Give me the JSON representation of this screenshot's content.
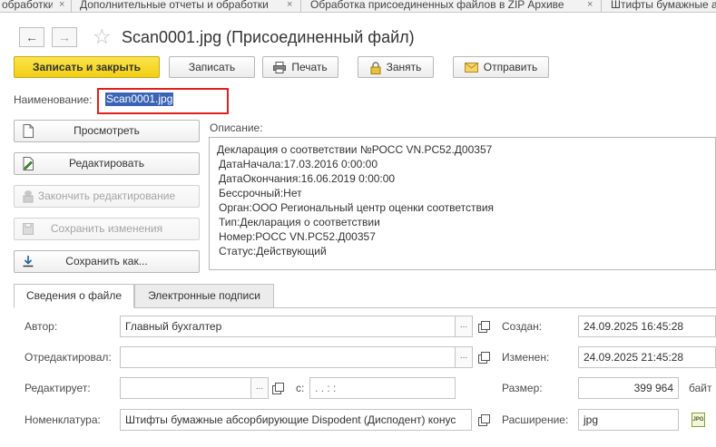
{
  "tabs": [
    {
      "label": "обработки"
    },
    {
      "label": "Дополнительные отчеты и обработки"
    },
    {
      "label": "Обработка присоединенных файлов в ZIP Архиве"
    },
    {
      "label": "Штифты бумажные а"
    }
  ],
  "tab_close_glyph": "×",
  "nav": {
    "back": "←",
    "forward": "→",
    "favorite": "☆"
  },
  "title": "Scan0001.jpg (Присоединенный файл)",
  "toolbar": {
    "save_close": "Записать и закрыть",
    "save": "Записать",
    "print": "Печать",
    "lock": "Занять",
    "send": "Отправить"
  },
  "name": {
    "label": "Наименование:",
    "value": "Scan0001.jpg"
  },
  "actions": {
    "view": "Просмотреть",
    "edit": "Редактировать",
    "finish_edit": "Закончить редактирование",
    "save_changes": "Сохранить изменения",
    "save_as": "Сохранить как..."
  },
  "description": {
    "label": "Описание:",
    "lines": [
      "Декларация о соответствии №РОСС VN.PC52.Д00357",
      "ДатаНачала:17.03.2016 0:00:00",
      "ДатаОкончания:16.06.2019 0:00:00",
      "Бессрочный:Нет",
      "Орган:ООО Региональный центр оценки соответствия",
      "Тип:Декларация о соответствии",
      "Номер:РОСС VN.PC52.Д00357",
      "Статус:Действующий"
    ]
  },
  "lower_tabs": {
    "info": "Сведения о файле",
    "signatures": "Электронные подписи"
  },
  "fields": {
    "author": {
      "label": "Автор:",
      "value": "Главный бухгалтер"
    },
    "edited_by": {
      "label": "Отредактировал:",
      "value": ""
    },
    "editing": {
      "label": "Редактирует:",
      "value": ""
    },
    "since": {
      "label": "с:",
      "value": " .  .      :  :"
    },
    "nomenclature": {
      "label": "Номенклатура:",
      "value": "Штифты бумажные абсорбирующие Dispodent (Дисподент) конус"
    },
    "created": {
      "label": "Создан:",
      "value": "24.09.2025 16:45:28"
    },
    "modified": {
      "label": "Изменен:",
      "value": "24.09.2025 21:45:28"
    },
    "size": {
      "label": "Размер:",
      "value": "399 964",
      "unit": "байт"
    },
    "extension": {
      "label": "Расширение:",
      "value": "jpg",
      "icon_text": "JPG"
    }
  },
  "more_glyph": "...",
  "colors": {
    "primary": "#f5d31c",
    "highlight": "#e0201f",
    "selection": "#3b64b5"
  }
}
